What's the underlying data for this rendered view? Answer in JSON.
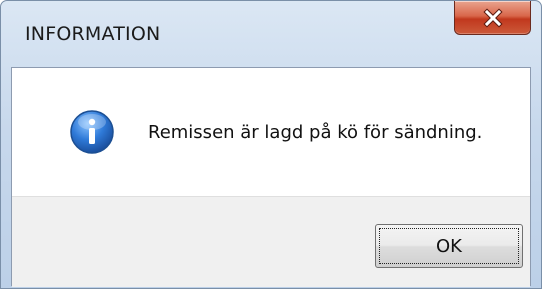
{
  "dialog": {
    "title": "INFORMATION",
    "message": "Remissen är lagd på kö för sändning.",
    "icon": "information-icon",
    "ok_label": "OK",
    "close_icon": "close-icon"
  },
  "colors": {
    "titlebar": "#c7d8ec",
    "close_button": "#c9482a",
    "client_background": "#ffffff",
    "button_area": "#f0f0f0",
    "info_icon": "#2a6fc9"
  }
}
